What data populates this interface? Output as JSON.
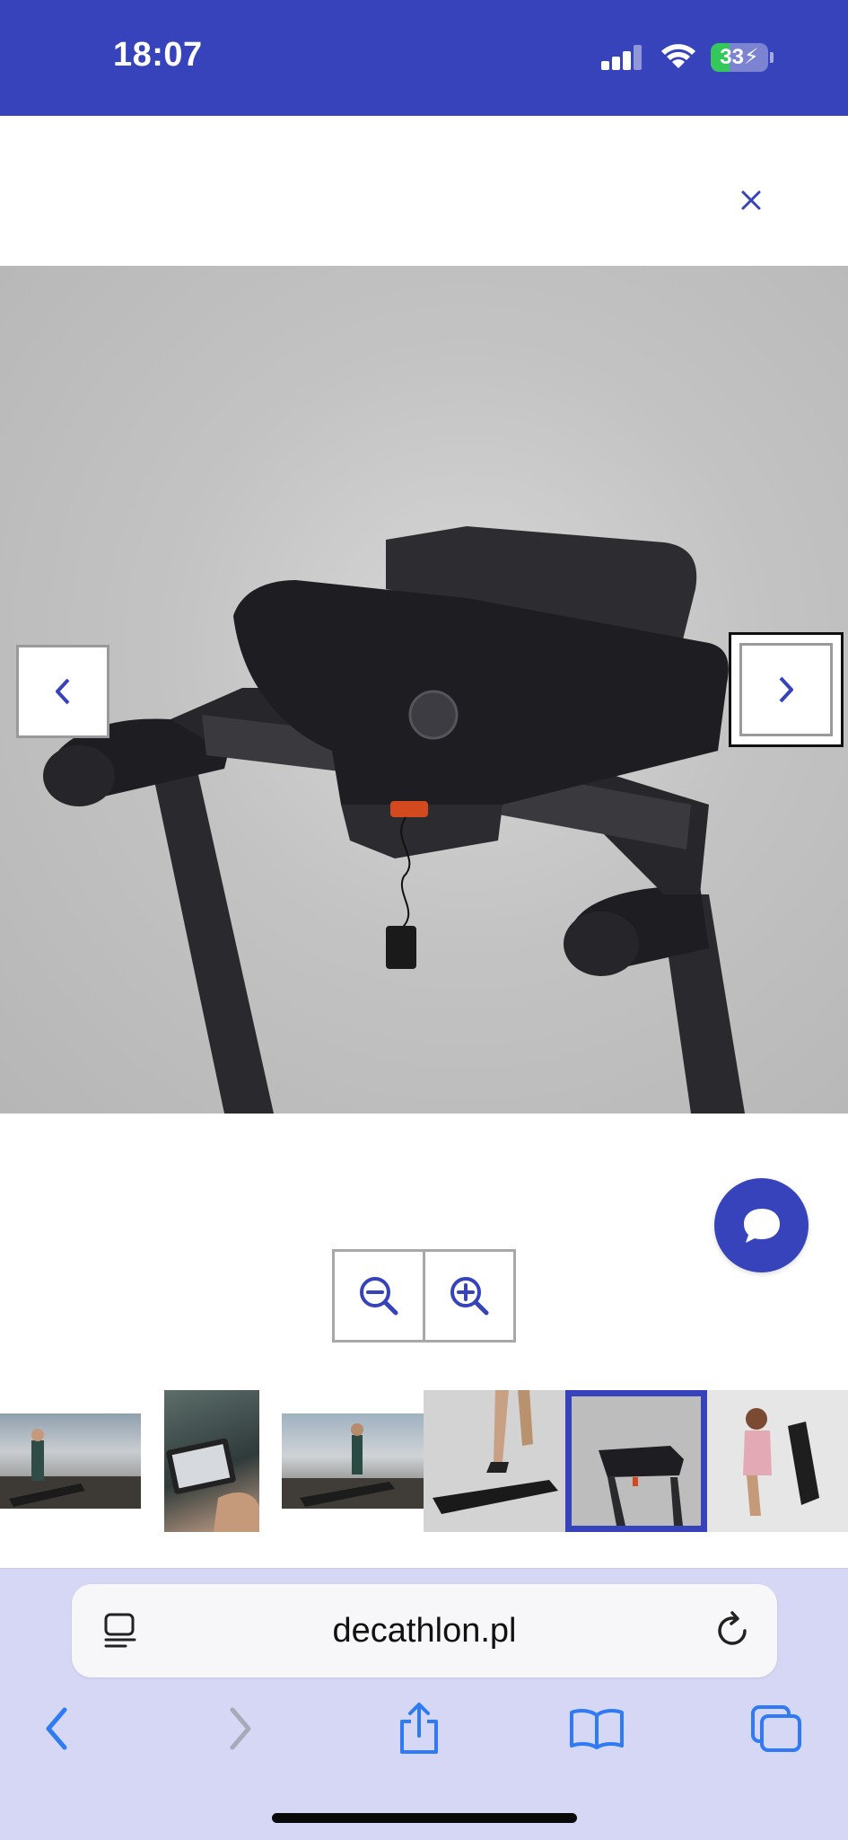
{
  "status_bar": {
    "time": "18:07",
    "battery_percent": "33",
    "background_color": "#3643BA",
    "icons": [
      "cellular-signal-icon",
      "wifi-icon",
      "battery-charging-icon"
    ]
  },
  "modal": {
    "close_icon": "close-icon",
    "accent_color": "#3643BA"
  },
  "gallery": {
    "main_image_subject": "treadmill-console-photo",
    "prev_icon": "chevron-left-icon",
    "next_icon": "chevron-right-icon",
    "zoom_out_icon": "zoom-out-icon",
    "zoom_in_icon": "zoom-in-icon",
    "selected_thumbnail_index": 4,
    "thumbnails": [
      {
        "subject": "woman-on-treadmill-window"
      },
      {
        "subject": "woman-with-tablet"
      },
      {
        "subject": "woman-running-on-treadmill"
      },
      {
        "subject": "legs-running-on-treadmill"
      },
      {
        "subject": "treadmill-console"
      },
      {
        "subject": "woman-moving-treadmill"
      }
    ]
  },
  "chat": {
    "icon": "chat-bubble-icon",
    "color": "#3643BA"
  },
  "browser": {
    "url": "decathlon.pl",
    "reader_icon": "page-format-icon",
    "reload_icon": "reload-icon",
    "toolbar": [
      "back-icon",
      "forward-icon",
      "share-icon",
      "bookmarks-icon",
      "tabs-icon"
    ],
    "tint_color": "#D5D7F5",
    "icon_color": "#2F7BF6"
  }
}
